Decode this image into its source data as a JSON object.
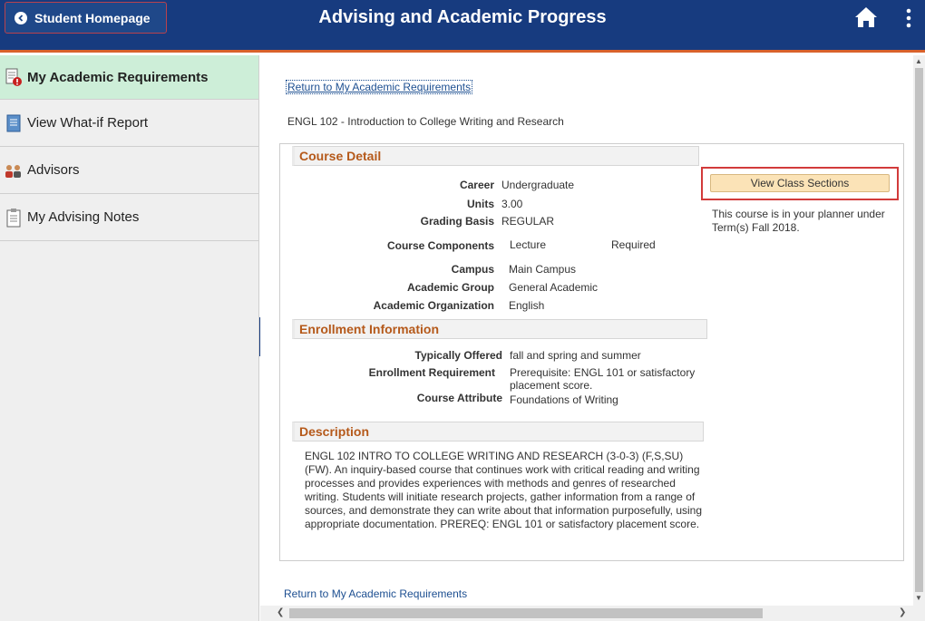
{
  "header": {
    "back_label": "Student Homepage",
    "title": "Advising and Academic Progress",
    "home_icon": "home-icon",
    "menu_icon": "kebab-menu-icon"
  },
  "sidebar": {
    "items": [
      {
        "label": "My Academic Requirements",
        "icon": "requirements-alert-icon",
        "active": true
      },
      {
        "label": "View What-if Report",
        "icon": "report-icon",
        "active": false
      },
      {
        "label": "Advisors",
        "icon": "people-icon",
        "active": false
      },
      {
        "label": "My Advising Notes",
        "icon": "clipboard-icon",
        "active": false
      }
    ]
  },
  "main": {
    "return_link": "Return to My Academic Requirements",
    "course_title": "ENGL  102 - Introduction to College Writing and Research",
    "view_sections_label": "View Class Sections",
    "planner_note": "This course is in your planner under Term(s) Fall 2018.",
    "course_detail": {
      "heading": "Course Detail",
      "career_label": "Career",
      "career": "Undergraduate",
      "units_label": "Units",
      "units": "3.00",
      "grading_label": "Grading Basis",
      "grading": "REGULAR",
      "components_label": "Course Components",
      "component": "Lecture",
      "component_status": "Required",
      "campus_label": "Campus",
      "campus": "Main Campus",
      "group_label": "Academic Group",
      "group": "General Academic",
      "org_label": "Academic Organization",
      "org": "English"
    },
    "enrollment": {
      "heading": "Enrollment Information",
      "offered_label": "Typically Offered",
      "offered": "fall and spring and summer",
      "requirement_label": "Enrollment Requirement",
      "requirement": "Prerequisite: ENGL 101 or satisfactory placement score.",
      "attribute_label": "Course Attribute",
      "attribute": "Foundations of Writing"
    },
    "description": {
      "heading": "Description",
      "text": "ENGL 102 INTRO TO COLLEGE WRITING AND RESEARCH (3-0-3) (F,S,SU)(FW). An inquiry-based course that continues work with critical reading and writing processes and provides experiences with methods and genres of researched writing. Students will initiate research projects, gather information from a range of sources, and demonstrate they can write about that information purposefully, using appropriate documentation. PREREQ: ENGL 101 or satisfactory placement score."
    }
  },
  "colors": {
    "header_bg": "#173b7f",
    "header_accent": "#d9622b",
    "active_nav": "#cdeed8",
    "section_heading": "#b5591a",
    "button_bg": "#fbe3b7",
    "highlight_frame": "#d23b3b"
  }
}
